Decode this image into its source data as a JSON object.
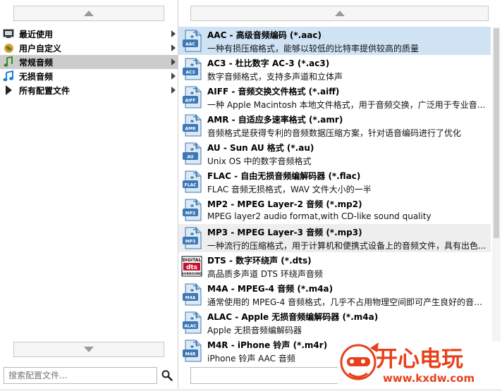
{
  "categories": [
    {
      "label": "最近使用",
      "icon": "monitor-icon"
    },
    {
      "label": "用户自定义",
      "icon": "globe-icon"
    },
    {
      "label": "常规音频",
      "icon": "music-note-icon"
    },
    {
      "label": "无损音频",
      "icon": "blue-music-note-icon"
    },
    {
      "label": "所有配置文件",
      "icon": "play-triangle-icon"
    }
  ],
  "selected_category": "常规音频",
  "search": {
    "placeholder": "搜索配置文件..."
  },
  "formats": [
    {
      "title": "AAC - 高级音频编码 (*.aac)",
      "desc": "一种有损压缩格式，能够以较低的比特率提供较高的质量",
      "badge": "AAC"
    },
    {
      "title": "AC3 - 杜比数字 AC-3 (*.ac3)",
      "desc": "数字音频格式，支持多声道和立体声",
      "badge": "AC3"
    },
    {
      "title": "AIFF - 音频交换文件格式 (*.aiff)",
      "desc": "一种 Apple Macintosh 本地文件格式，用于音频交换，广泛用于专业音...",
      "badge": "AIFF"
    },
    {
      "title": "AMR - 自适应多速率格式 (*.amr)",
      "desc": "音频格式是获得专利的音频数据压缩方案，针对语音编码进行了优化",
      "badge": "AMR"
    },
    {
      "title": "AU - Sun AU 格式 (*.au)",
      "desc": "Unix OS 中的数字音频格式",
      "badge": "AU"
    },
    {
      "title": "FLAC - 自由无损音频编解码器 (*.flac)",
      "desc": "FLAC 音频无损格式，WAV 文件大小的一半",
      "badge": "FLAC"
    },
    {
      "title": "MP2 - MPEG Layer-2 音频 (*.mp2)",
      "desc": "MPEG layer2 audio format,with CD-like sound quality",
      "badge": "MP2"
    },
    {
      "title": "MP3 - MPEG Layer-3 音频 (*.mp3)",
      "desc": "一种流行的压缩格式，用于计算机和便携式设备上的音频文件，具有出色...",
      "badge": "MP3"
    },
    {
      "title": "DTS - 数字环绕声 (*.dts)",
      "desc": "高品质多声道 DTS 环绕声音频",
      "badge": "DTS"
    },
    {
      "title": "M4A - MPEG-4 音频 (*.m4a)",
      "desc": "通常使用的 MPEG-4 音频格式，几乎不占用物理空间即可产生良好的音频...",
      "badge": "M4A"
    },
    {
      "title": "ALAC - Apple 无损音频编解码器 (*.m4a)",
      "desc": "Apple 无损音频编解码器",
      "badge": "ALAC"
    },
    {
      "title": "M4R - iPhone 铃声 (*.m4r)",
      "desc": "iPhone 铃声 AAC 音频",
      "badge": "M4R"
    }
  ],
  "dts_logo": {
    "top": "DIGITAL",
    "mid": "dts",
    "bottom": "SURROUND"
  },
  "watermark": {
    "title": "开心电玩",
    "url": "www.kxdw.com"
  },
  "colors": {
    "selected_row": "#cfe3f5",
    "selected_category": "#cccccc",
    "watermark": "#e8401c"
  }
}
